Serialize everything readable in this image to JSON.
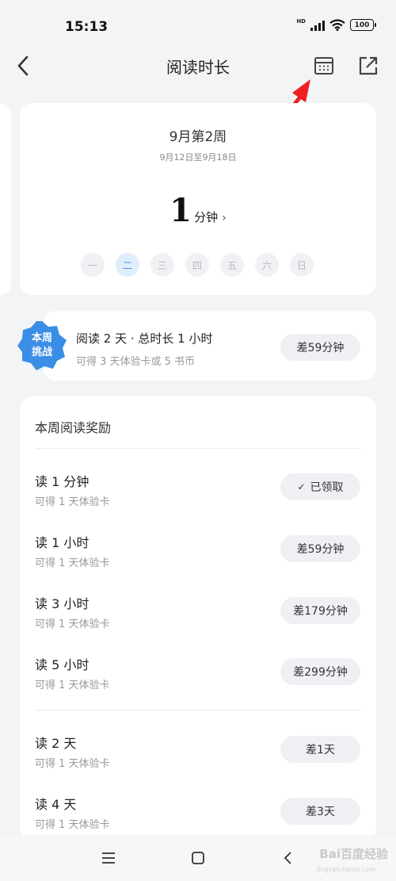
{
  "status_bar": {
    "time": "15:13",
    "network": "HD",
    "battery": "100"
  },
  "header": {
    "title": "阅读时长"
  },
  "week_card": {
    "title": "9月第2周",
    "range": "9月12日至9月18日",
    "total_value": "1",
    "total_unit": "分钟",
    "days": [
      "一",
      "二",
      "三",
      "四",
      "五",
      "六",
      "日"
    ],
    "active_day_index": 1
  },
  "challenge": {
    "badge_line1": "本周",
    "badge_line2": "挑战",
    "title": "阅读 2 天 · 总时长 1 小时",
    "subtitle": "可得 3 天体验卡或 5 书币",
    "status": "差59分钟"
  },
  "rewards": {
    "title": "本周阅读奖励",
    "items": [
      {
        "title": "读 1 分钟",
        "subtitle": "可得 1 天体验卡",
        "status": "已领取",
        "claimed": true
      },
      {
        "title": "读 1 小时",
        "subtitle": "可得 1 天体验卡",
        "status": "差59分钟",
        "claimed": false
      },
      {
        "title": "读 3 小时",
        "subtitle": "可得 1 天体验卡",
        "status": "差179分钟",
        "claimed": false
      },
      {
        "title": "读 5 小时",
        "subtitle": "可得 1 天体验卡",
        "status": "差299分钟",
        "claimed": false
      },
      {
        "title": "读 2 天",
        "subtitle": "可得 1 天体验卡",
        "status": "差1天",
        "claimed": false
      },
      {
        "title": "读 4 天",
        "subtitle": "可得 1 天体验卡",
        "status": "差3天",
        "claimed": false
      }
    ]
  },
  "watermark": {
    "text": "Bai百度经验",
    "sub": "jingyan.baidu.com"
  },
  "colors": {
    "accent": "#4b8fe0",
    "badge": "#3a8ee6",
    "annotation_arrow": "#f02020"
  }
}
